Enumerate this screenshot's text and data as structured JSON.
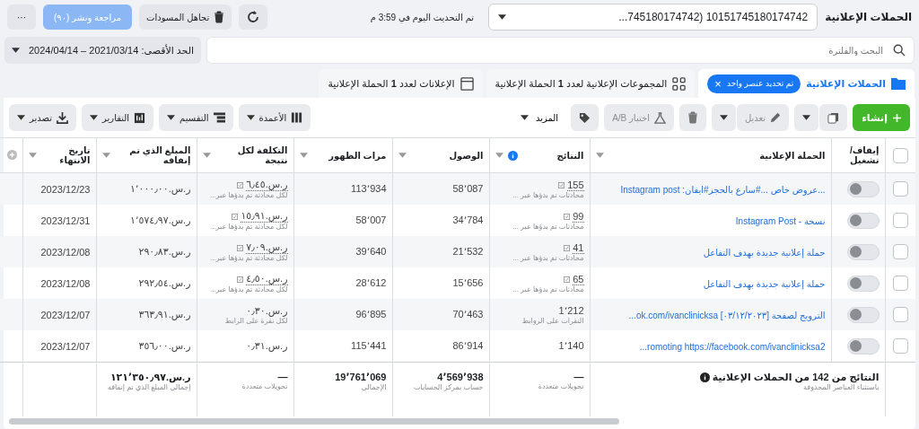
{
  "header": {
    "title": "الحملات الإعلانية",
    "account": "10151745180174742 (745180174742...",
    "updated": "تم التحديث اليوم في 3:59 م",
    "discard": "تجاهل المسودات",
    "review": {
      "label": "مراجعة ونشر (٩٠)",
      "disabled": true
    },
    "more": "···"
  },
  "search": {
    "placeholder": "البحث والفلترة"
  },
  "date_range": "الحد الأقصى: 2021/03/14 – 2024/04/14",
  "tabs": [
    {
      "label": "الحملات الإعلانية",
      "selected": true,
      "chip": "تم تحديد عنصر واحد",
      "chip_close": "×"
    },
    {
      "label": "المجموعات الإعلانية لعدد **1** الحملة الإعلانية",
      "selected": false
    },
    {
      "label": "الإعلانات لعدد **1** الحملة الإعلانية",
      "selected": false
    }
  ],
  "toolbar": {
    "create": "إنشاء",
    "edit": {
      "label": "تعديل",
      "disabled": true
    },
    "ab_test": {
      "label": "اختبار A/B",
      "disabled": true
    },
    "more": "المزيد",
    "columns": "الأعمدة",
    "breakdown": "التقسيم",
    "reports": "التقارير",
    "export": "تصدير"
  },
  "table": {
    "select_all": {
      "checked": false
    },
    "columns": [
      "إيقاف/ تشغيل",
      "الحملة الإعلانية",
      "النتائج",
      "الوصول",
      "مرات الظهور",
      "التكلفة لكل نتيجة",
      "المبلغ الذي تم إنفاقه",
      "تاريخ الانتهاء"
    ],
    "rows": [
      {
        "checked": false,
        "on": false,
        "name": "...عروض خاص ...#سارع بالحجز#ايفان: Instagram post",
        "results": "155",
        "results_note": "محادثات تم بدؤها عبر ...",
        "annotated": true,
        "reach": "58٬087",
        "impressions": "113٬934",
        "cost": "ر.س.٦٫٤٥",
        "cost_note": "لكل محادثة تم بدؤها عبر...",
        "spent": "ر.س.١٬٠٠٠٫٠٠",
        "end": "2023/12/23"
      },
      {
        "checked": false,
        "on": false,
        "name": "نسخة - Instagram Post",
        "results": "99",
        "results_note": "محادثات تم بدؤها عبر ...",
        "annotated": true,
        "reach": "34٬784",
        "impressions": "58٬007",
        "cost": "ر.س.١٥٫٩١",
        "cost_note": "لكل محادثة تم بدؤها عبر...",
        "spent": "ر.س.١٬٥٧٤٫٩٧",
        "end": "2023/12/31"
      },
      {
        "checked": false,
        "on": false,
        "name": "حملة إعلانية جديدة بهدف التفاعل",
        "results": "41",
        "results_note": "محادثات تم بدؤها عبر ...",
        "annotated": true,
        "reach": "21٬532",
        "impressions": "39٬640",
        "cost": "ر.س.٧٫٠٩",
        "cost_note": "لكل محادثة تم بدؤها عبر...",
        "spent": "ر.س.٢٩٠٫٨٣",
        "end": "2023/12/08"
      },
      {
        "checked": false,
        "on": false,
        "name": "حملة إعلانية جديدة بهدف التفاعل",
        "results": "65",
        "results_note": "محادثات تم بدؤها عبر ...",
        "annotated": true,
        "reach": "15٬656",
        "impressions": "28٬612",
        "cost": "ر.س.٤٫٥٠",
        "cost_note": "لكل محادثة تم بدؤها عبر...",
        "spent": "ر.س.٢٩٢٫٥٤",
        "end": "2023/12/08"
      },
      {
        "checked": false,
        "on": false,
        "name": "...ok.com/ivanclinicksa الترويج لصفحة [٠٣/١٢/٢٠٢٣]",
        "results": "1٬212",
        "results_note": "النقرات على الروابط",
        "annotated": false,
        "reach": "70٬463",
        "impressions": "96٬895",
        "cost": "ر.س.٠٫٣٠",
        "cost_note": "لكل نقرة على الرابط",
        "spent": "ر.س.٣٦٣٫٩١",
        "end": "2023/12/07"
      },
      {
        "checked": false,
        "on": false,
        "name": "...romoting https://facebook.com/ivanclinicksa2",
        "results": "1٬140",
        "annotated": false,
        "reach": "86٬914",
        "impressions": "115٬441",
        "cost": "ر.س.٠٫٣١",
        "spent": "ر.س.٣٥٦٫٠٠",
        "end": "2023/12/07"
      }
    ],
    "totals": {
      "label": "النتائج من 142 من الحملات الإعلانية",
      "label_note": "باستثناء العناصر المحذوفة",
      "results": "—",
      "results_note": "تحويلات متعددة",
      "reach": "4٬569٬938",
      "reach_note": "حساب بمركز الحسابات",
      "impressions": "19٬761٬069",
      "impressions_note": "الإجمالي",
      "cost": "—",
      "cost_note": "تحويلات متعددة",
      "spent": "ر.س.١٢١٬٣٥٠٫٩٧",
      "spent_note": "إجمالي المبلغ الذي تم إنفاقه"
    }
  }
}
